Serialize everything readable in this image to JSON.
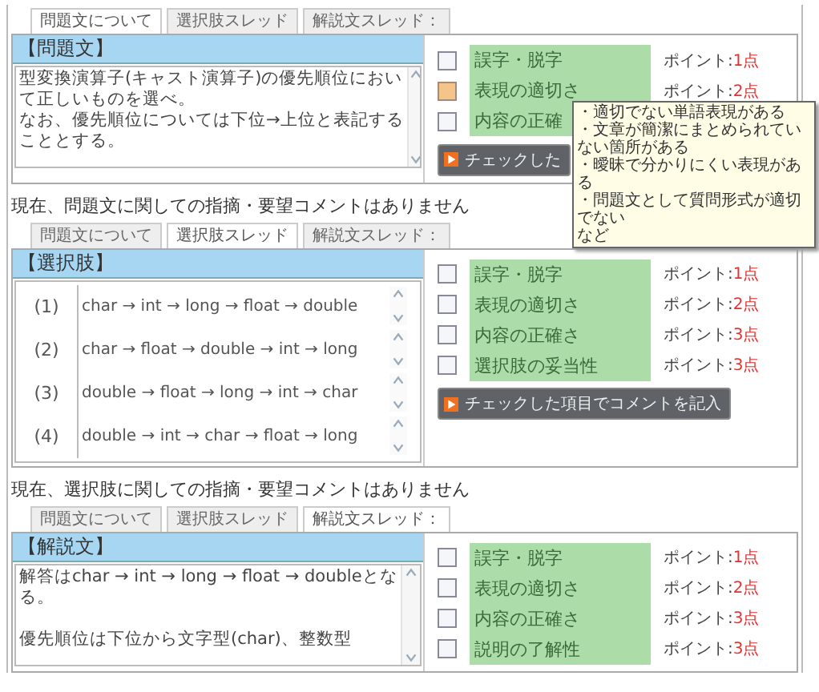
{
  "sections": [
    {
      "tabs": [
        {
          "label": "問題文について",
          "selected": true
        },
        {
          "label": "選択肢スレッド",
          "selected": false
        },
        {
          "label": "解説文スレッド：",
          "selected": false
        }
      ],
      "heading": "【問題文】",
      "kind": "text",
      "paragraphs": [
        [
          "型変換演算子(キャスト演算子)の優先順位におい",
          "て正しいものを選べ。",
          "なお、優先順位については下位→上位と表記する",
          "こととする。"
        ]
      ],
      "checks": [
        {
          "label": "誤字・脱字",
          "checked": false,
          "points_label": "ポイント:",
          "points": "1点"
        },
        {
          "label": "表現の適切さ",
          "checked": true,
          "points_label": "ポイント:",
          "points": "2点"
        },
        {
          "label": "内容の正確",
          "checked": false
        }
      ],
      "button": "チェックした",
      "tooltip": [
        "・適切でない単語表現がある",
        "・文章が簡潔にまとめられていない箇所がある",
        "・曖昧で分かりにくい表現がある",
        "・問題文として質問形式が適切でない",
        "など"
      ],
      "comment": "現在、問題文に関しての指摘・要望コメントはありません"
    },
    {
      "tabs": [
        {
          "label": "問題文について",
          "selected": false
        },
        {
          "label": "選択肢スレッド",
          "selected": true
        },
        {
          "label": "解説文スレッド：",
          "selected": false
        }
      ],
      "heading": "【選択肢】",
      "kind": "choices",
      "choices": [
        {
          "number": "(1)",
          "text": "char → int → long → float → double"
        },
        {
          "number": "(2)",
          "text": "char → float → double → int → long"
        },
        {
          "number": "(3)",
          "text": "double → float → long → int → char"
        },
        {
          "number": "(4)",
          "text": "double → int → char → float → long"
        }
      ],
      "checks": [
        {
          "label": "誤字・脱字",
          "checked": false,
          "points_label": "ポイント:",
          "points": "1点"
        },
        {
          "label": "表現の適切さ",
          "checked": false,
          "points_label": "ポイント:",
          "points": "2点"
        },
        {
          "label": "内容の正確さ",
          "checked": false,
          "points_label": "ポイント:",
          "points": "3点"
        },
        {
          "label": "選択肢の妥当性",
          "checked": false,
          "points_label": "ポイント:",
          "points": "3点"
        }
      ],
      "button": "チェックした項目でコメントを記入",
      "comment": "現在、選択肢に関しての指摘・要望コメントはありません"
    },
    {
      "tabs": [
        {
          "label": "問題文について",
          "selected": false
        },
        {
          "label": "選択肢スレッド",
          "selected": false
        },
        {
          "label": "解説文スレッド：",
          "selected": true
        }
      ],
      "heading": "【解説文】",
      "kind": "text",
      "paragraphs": [
        [
          "解答はchar → int → long → float → doubleとな",
          "る。"
        ],
        [
          "優先順位は下位から文字型(char)、整数型"
        ]
      ],
      "checks": [
        {
          "label": "誤字・脱字",
          "checked": false,
          "points_label": "ポイント:",
          "points": "1点"
        },
        {
          "label": "表現の適切さ",
          "checked": false,
          "points_label": "ポイント:",
          "points": "2点"
        },
        {
          "label": "内容の正確さ",
          "checked": false,
          "points_label": "ポイント:",
          "points": "3点"
        },
        {
          "label": "説明の了解性",
          "checked": false,
          "points_label": "ポイント:",
          "points": "3点"
        }
      ]
    }
  ]
}
